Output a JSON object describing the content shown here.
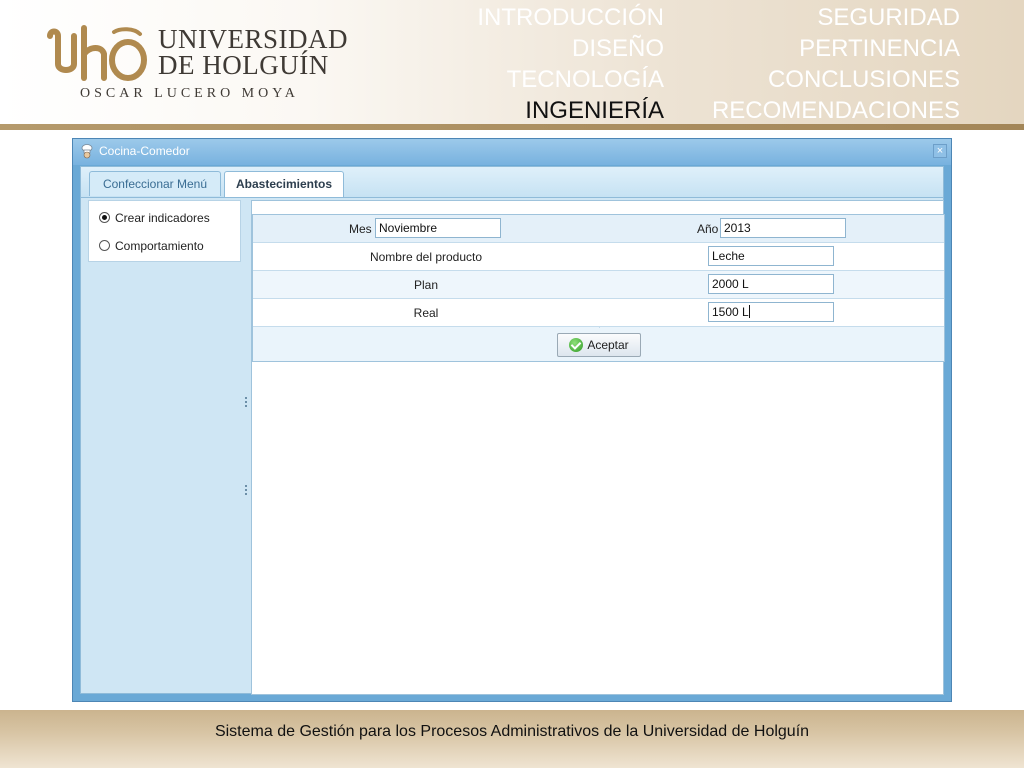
{
  "slide": {
    "logo": {
      "line1": "UNIVERSIDAD",
      "line2": "DE HOLGUÍN",
      "line3": "OSCAR LUCERO MOYA"
    },
    "nav_left": [
      "INTRODUCCIÓN",
      "DISEÑO",
      "TECNOLOGÍA",
      "INGENIERÍA"
    ],
    "nav_right": [
      "SEGURIDAD",
      "PERTINENCIA",
      "CONCLUSIONES",
      "RECOMENDACIONES"
    ],
    "active_nav": "INGENIERÍA",
    "footer": "Sistema de Gestión para los Procesos Administrativos de la Universidad de Holguín"
  },
  "window": {
    "title": "Cocina-Comedor",
    "close_label": "×",
    "tabs": [
      {
        "label": "Confeccionar Menú",
        "active": false
      },
      {
        "label": "Abastecimientos",
        "active": true
      }
    ],
    "options": [
      {
        "label": "Crear indicadores",
        "selected": true
      },
      {
        "label": "Comportamiento",
        "selected": false
      }
    ],
    "form": {
      "mes_label": "Mes",
      "mes_value": "Noviembre",
      "anio_label": "Año",
      "anio_value": "2013",
      "rows": [
        {
          "label": "Nombre del producto",
          "value": "Leche"
        },
        {
          "label": "Plan",
          "value": "2000 L"
        },
        {
          "label": "Real",
          "value": "1500 L"
        }
      ],
      "accept_label": "Aceptar"
    }
  },
  "colors": {
    "accent_bronze": "#b59a6c",
    "window_blue": "#6aa9d6",
    "active_nav": "#111111"
  }
}
